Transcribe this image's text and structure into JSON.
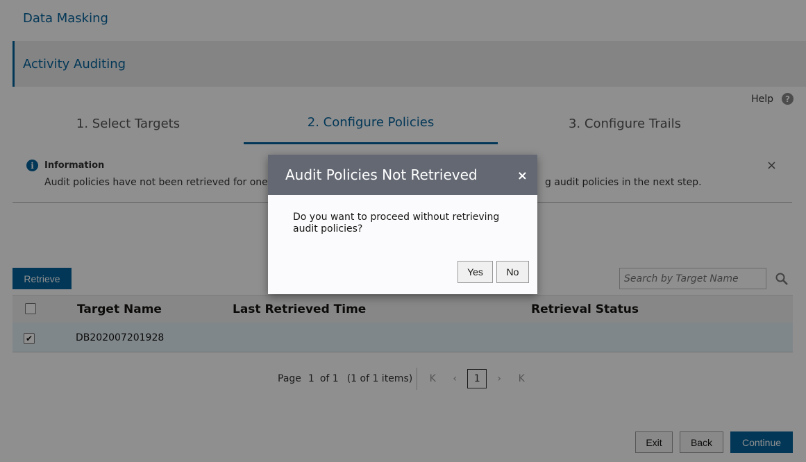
{
  "nav": {
    "data_masking": "Data Masking",
    "activity_auditing": "Activity Auditing"
  },
  "help": {
    "label": "Help",
    "icon": "?"
  },
  "train": {
    "steps": [
      "1. Select Targets",
      "2. Configure Policies",
      "3. Configure Trails"
    ],
    "active_index": 1
  },
  "info": {
    "title": "Information",
    "text_left": "Audit policies have not been retrieved for one",
    "text_right": "g audit policies in the next step.",
    "icon": "i",
    "close": "×"
  },
  "toolbar": {
    "retrieve_label": "Retrieve",
    "search_placeholder": "Search by Target Name"
  },
  "table": {
    "columns": [
      "Target Name",
      "Last Retrieved Time",
      "Retrieval Status"
    ],
    "rows": [
      {
        "checked": true,
        "target_name": "DB202007201928",
        "last_retrieved_time": "",
        "retrieval_status": ""
      }
    ],
    "check_mark": "✔"
  },
  "pagination": {
    "page_label": "Page",
    "current_page": "1",
    "of_label": "of 1",
    "items_summary": "(1 of 1 items)",
    "first": "K",
    "prev": "‹",
    "next": "›",
    "last": "K",
    "page_button": "1"
  },
  "footer": {
    "exit_label": "Exit",
    "back_label": "Back",
    "continue_label": "Continue"
  },
  "dialog": {
    "title": "Audit Policies Not Retrieved",
    "close": "×",
    "message": "Do you want to proceed without retrieving audit policies?",
    "yes_label": "Yes",
    "no_label": "No"
  },
  "colors": {
    "accent": "#04639c",
    "dialog_header": "#636873",
    "row_selected": "#e4f1f7"
  }
}
